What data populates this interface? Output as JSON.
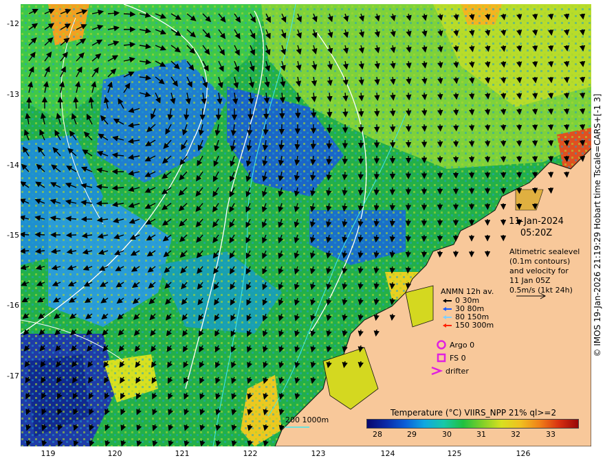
{
  "map": {
    "y_axis_labels": [
      "-12",
      "-13",
      "-14",
      "-15",
      "-16",
      "-17"
    ],
    "x_axis_labels": [
      "119",
      "120",
      "121",
      "122",
      "123",
      "124",
      "125",
      "126"
    ],
    "credit": "© IMOS 19-Jan-2026 21:19:29 Hobart time Tscale=CARS+[-1 3]",
    "date": "11-Jan-2024",
    "time": "05:20Z",
    "description_lines": [
      "Altimetric sealevel",
      "(0.1m contours)",
      "and velocity for",
      "11 Jan 05Z",
      "0.5m/s (1kt 24h)"
    ],
    "anmn_title": "ANMN 12h av.",
    "anmn_items": [
      {
        "label": "0 30m",
        "color": "#000000"
      },
      {
        "label": "30 80m",
        "color": "#1a5cff"
      },
      {
        "label": "80 150m",
        "color": "#7fd0ff"
      },
      {
        "label": "150 300m",
        "color": "#ff2200"
      }
    ],
    "argo_label": "Argo 0",
    "fs_label": "FS 0",
    "drifter_label": "drifter",
    "bathy_label": "200  1000m",
    "colorbar_title": "Temperature (°C) VIIRS_NPP 21% ql>=2",
    "colorbar_ticks": [
      "28",
      "29",
      "30",
      "31",
      "32",
      "33"
    ],
    "colors": {
      "land": "#f8c89a",
      "sst_warm": "#d8e020",
      "sst_mid": "#22b84a",
      "sst_cool": "#1a7ad8",
      "marker": "#e020e0"
    }
  }
}
